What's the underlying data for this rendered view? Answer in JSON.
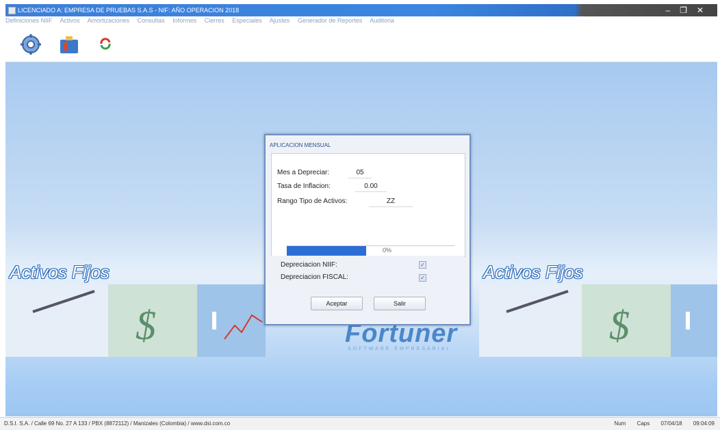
{
  "window": {
    "title": "LICENCIADO A: EMPRESA DE PRUEBAS S.A.S - NIF: AÑO OPERACION 2018",
    "controls": [
      "–",
      "❐",
      "✕"
    ]
  },
  "menu": {
    "items": [
      "Definiciones NIIF",
      "Activos",
      "Amortizaciones",
      "Consultas",
      "Informes",
      "Cierres",
      "Especiales",
      "Ajustes",
      "Generador de Reportes",
      "Auditoria"
    ]
  },
  "main": {
    "brand_left": "Activos Fijos",
    "brand_right": "Activos Fijos",
    "logo_text": "Fortuner",
    "logo_sub": "SOFTWARE EMPRESARIAL"
  },
  "dialog": {
    "title": "APLICACION MENSUAL",
    "mes_label": "Mes a Depreciar:",
    "mes_value": "05",
    "tasa_label": "Tasa de Inflacion:",
    "tasa_value": "0.00",
    "rango_label": "Rango Tipo de Activos:",
    "rango_value": "ZZ",
    "progress": 0.47,
    "progress_text": "0%",
    "dep_niif_label": "Depreciacion NIIF:",
    "dep_niif_checked": true,
    "dep_fiscal_label": "Depreciacion FISCAL:",
    "dep_fiscal_checked": true,
    "accept_label": "Aceptar",
    "exit_label": "Salir"
  },
  "status": {
    "company": "D.S.I. S.A. / Calle 69 No. 27 A 133 / PBX (8872112) / Manizales (Colombia) / www.dsi.com.co",
    "num": "Num",
    "caps": "Caps",
    "date": "07/04/18",
    "time": "09:04:09"
  },
  "colors": {
    "accent": "#2c6ed5",
    "title_bar": "#3a86e0",
    "background": "#c7ddf4"
  }
}
